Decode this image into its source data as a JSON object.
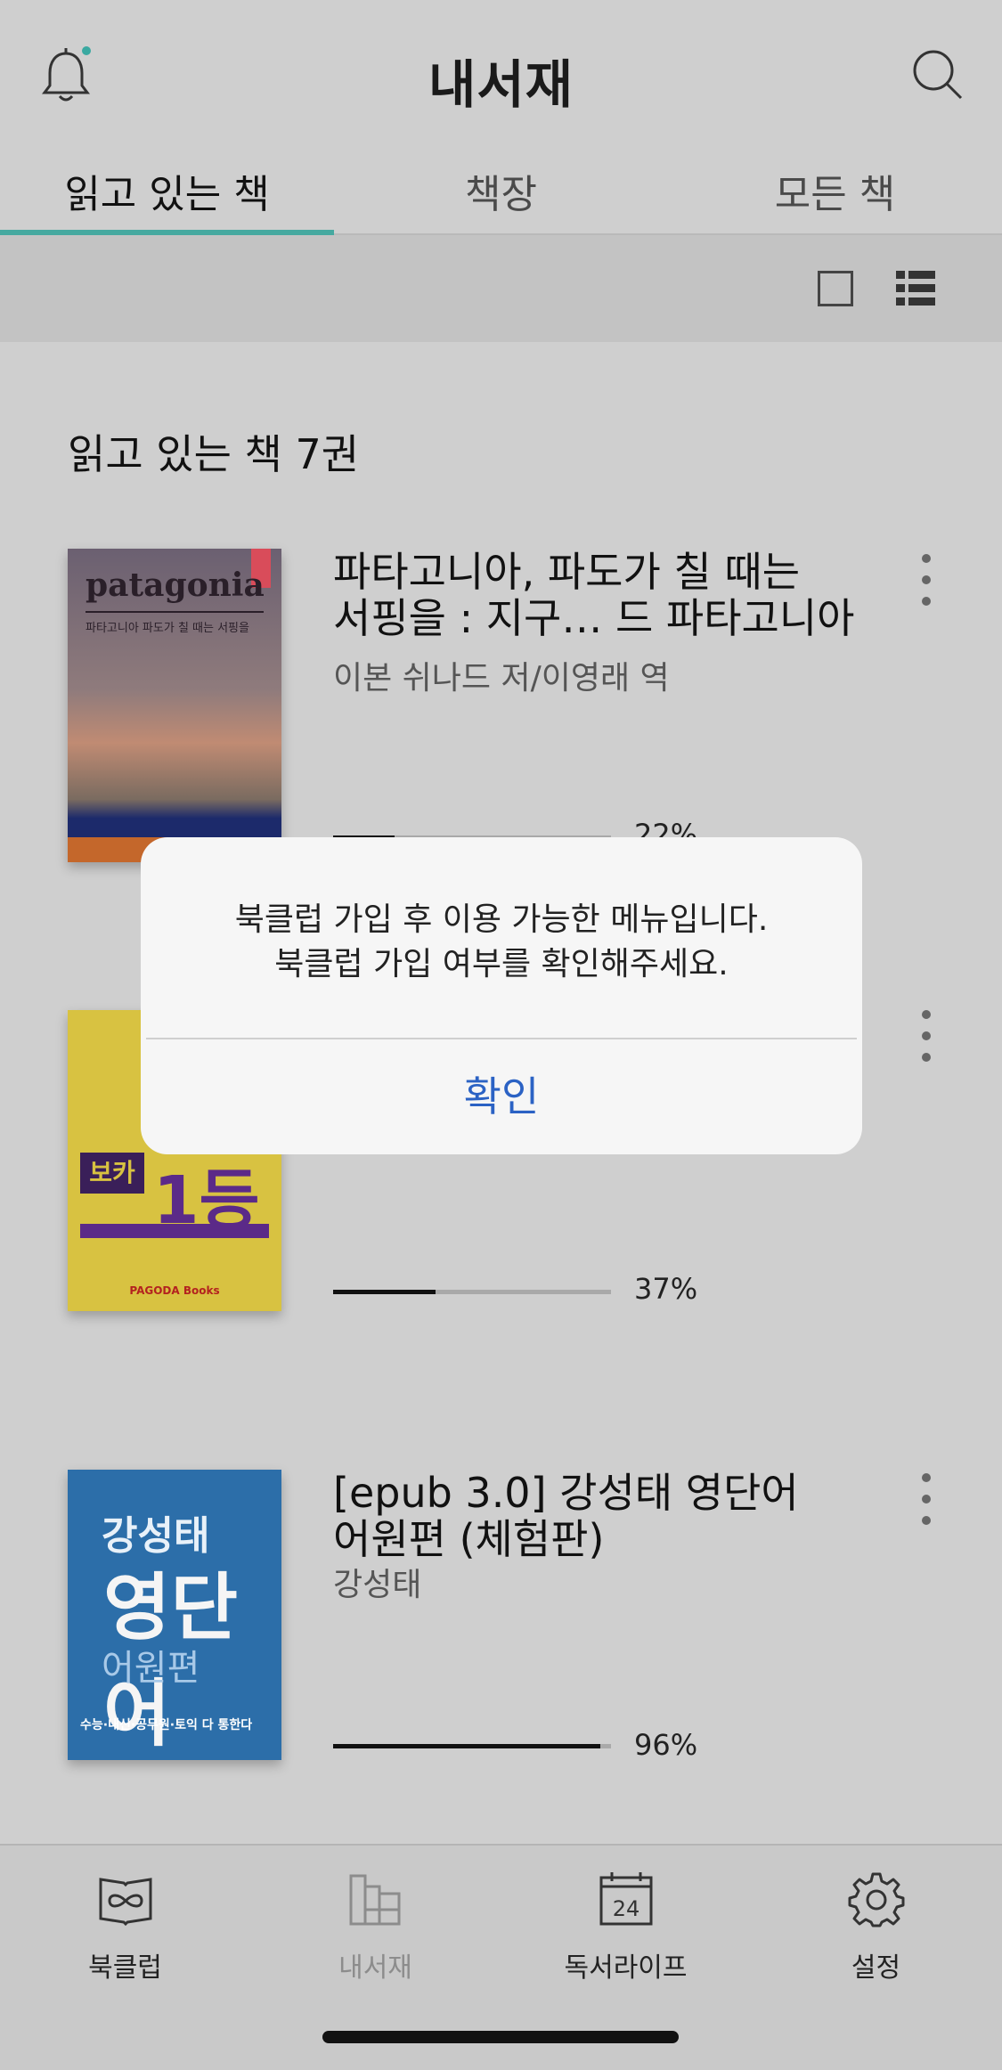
{
  "header": {
    "title": "내서재"
  },
  "tabs": [
    {
      "label": "읽고 있는 책"
    },
    {
      "label": "책장"
    },
    {
      "label": "모든 책"
    }
  ],
  "section": {
    "count_label": "읽고 있는 책 7권"
  },
  "books": [
    {
      "title_line1": "파타고니아, 파도가 칠 때는",
      "title_line2": "서핑을 : 지구… 드 파타고니아",
      "author": "이본 쉬나드 저/이영래 역",
      "progress": "22%",
      "progress_value": 22,
      "cover_text": "patagonia",
      "cover_sub": "파타고니아 파도가 칠 때는 서핑을"
    },
    {
      "title_line1": "",
      "title_line2": "",
      "author": "",
      "progress": "37%",
      "progress_value": 37,
      "cover_text_a": "보카",
      "cover_text_b": "1등",
      "cover_pub": "PAGODA Books"
    },
    {
      "title_line1": "[epub 3.0] 강성태 영단어",
      "title_line2": "어원편 (체험판)",
      "author": "강성태",
      "progress": "96%",
      "progress_value": 96,
      "cover_t1": "강성태",
      "cover_t2": "영단어",
      "cover_t3": "어원편",
      "cover_foot": "수능·내신·공무원·토익 다 통한다"
    }
  ],
  "dialog": {
    "line1": "북클럽 가입 후 이용 가능한 메뉴입니다.",
    "line2": "북클럽 가입 여부를 확인해주세요.",
    "confirm": "확인"
  },
  "bottom_nav": [
    {
      "label": "북클럽",
      "icon": "book-infinity-icon"
    },
    {
      "label": "내서재",
      "icon": "library-icon"
    },
    {
      "label": "독서라이프",
      "icon": "calendar-icon",
      "calendar_day": "24"
    },
    {
      "label": "설정",
      "icon": "gear-icon"
    }
  ],
  "colors": {
    "accent": "#46a9a0",
    "dialog_button": "#2b62c4",
    "background": "#cfcfcf"
  }
}
